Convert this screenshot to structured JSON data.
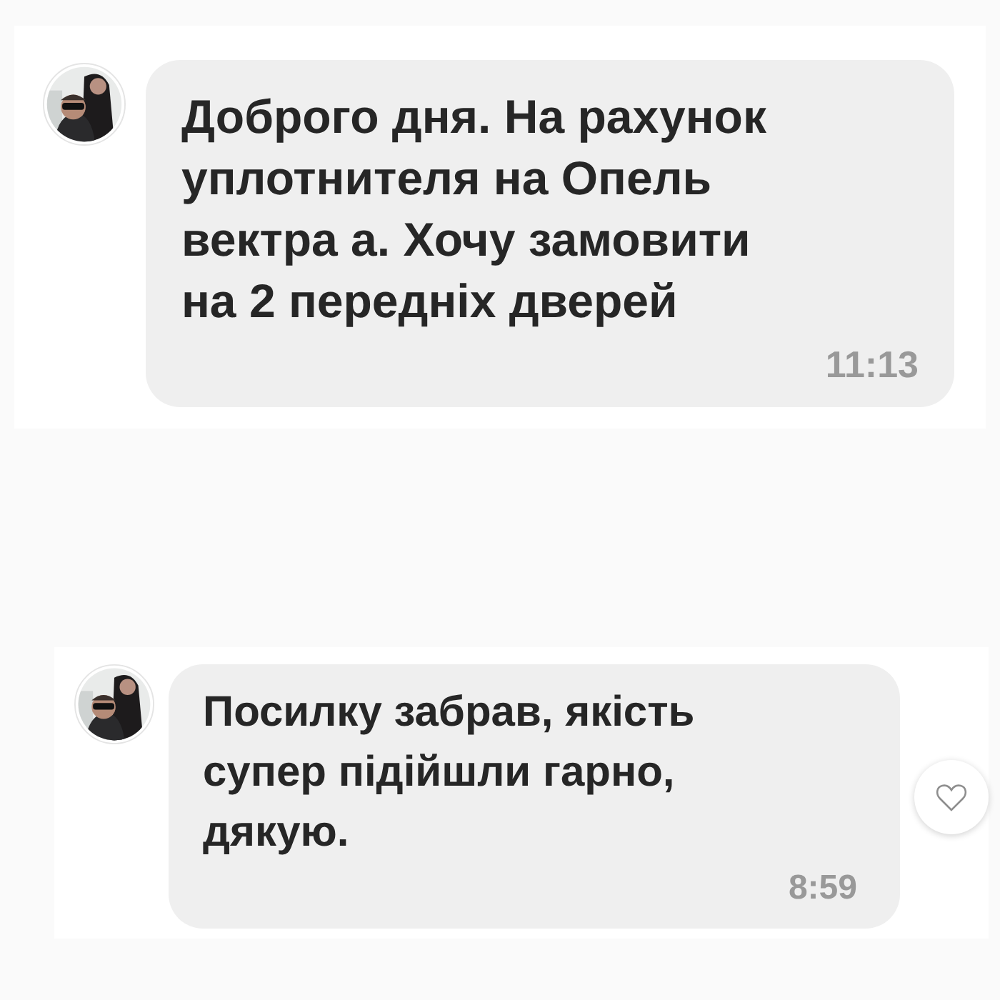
{
  "messages": [
    {
      "text": "Доброго дня. На рахунок уплотнителя на Опель вектра а. Хочу замовити на 2 передніх дверей",
      "time": "11:13",
      "like_button": false
    },
    {
      "text": "Посилку забрав, якість супер підійшли гарно, дякую.",
      "time": "8:59",
      "like_button": true
    }
  ]
}
